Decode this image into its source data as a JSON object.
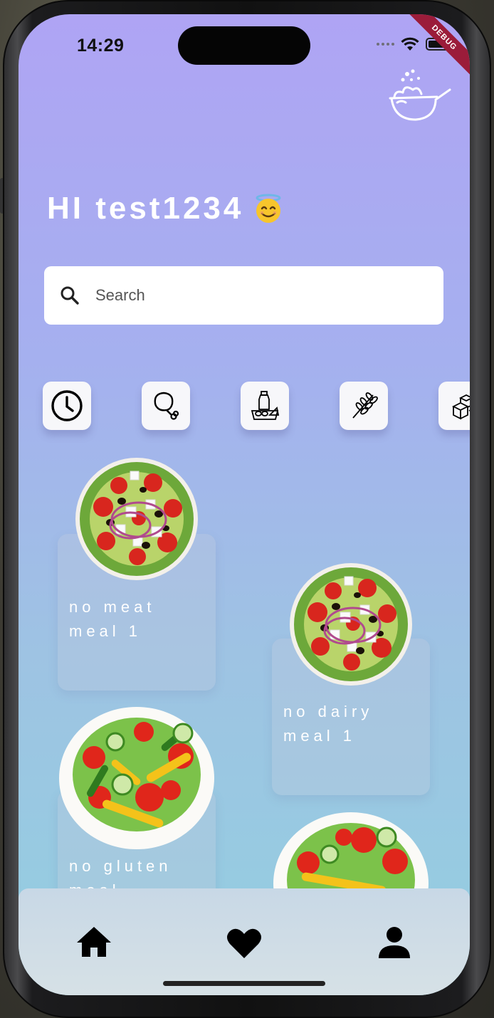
{
  "status_bar": {
    "time": "14:29"
  },
  "debug_banner": "DEBUG",
  "header": {
    "greeting": "HI test1234"
  },
  "search": {
    "placeholder": "Search"
  },
  "categories": [
    {
      "icon": "clock-icon"
    },
    {
      "icon": "chicken-leg-icon"
    },
    {
      "icon": "dairy-icon"
    },
    {
      "icon": "wheat-icon"
    },
    {
      "icon": "sugar-cubes-icon"
    }
  ],
  "meals": [
    {
      "title": "no meat\nmeal 1"
    },
    {
      "title": "no dairy\nmeal 1"
    },
    {
      "title": "no gluten\nmeal"
    }
  ],
  "tabs": [
    {
      "icon": "home-icon"
    },
    {
      "icon": "heart-icon"
    },
    {
      "icon": "profile-icon"
    }
  ]
}
